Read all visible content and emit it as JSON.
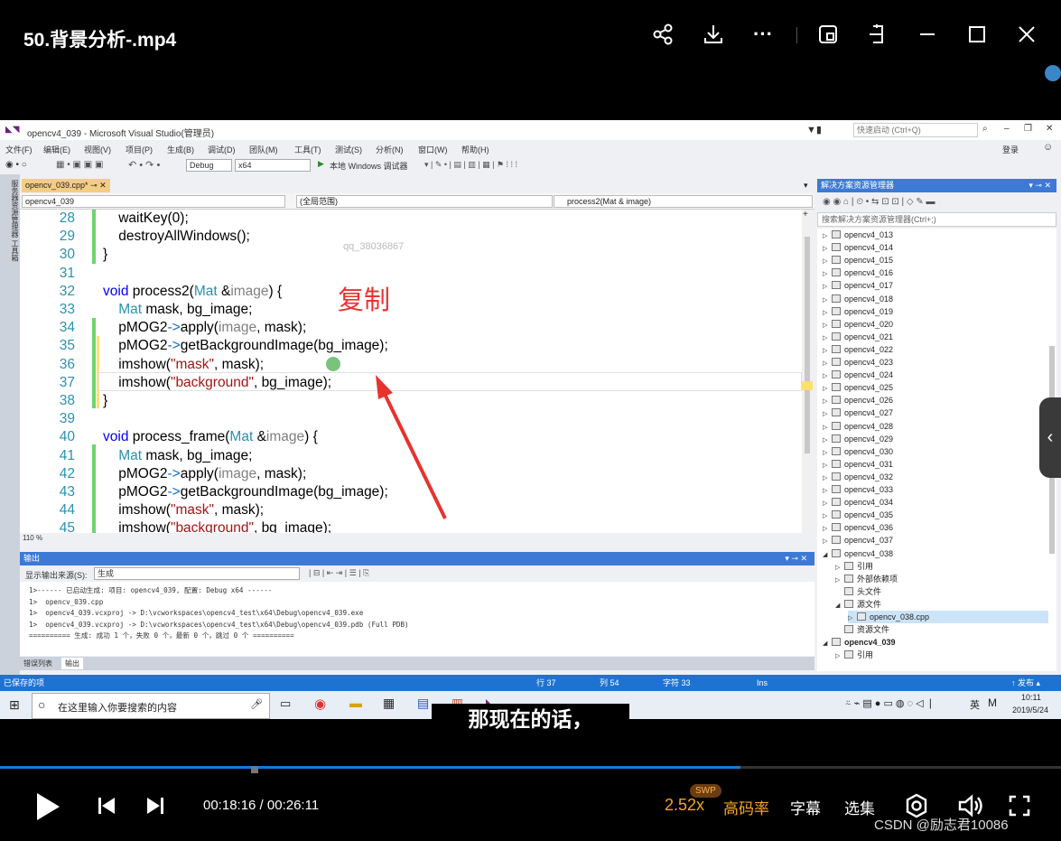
{
  "player": {
    "title": "50.背景分析-.mp4",
    "current_time": "00:18:16",
    "total_time": "00:26:11",
    "time_display": "00:18:16 / 00:26:11",
    "progress": 0.6977,
    "speed": "2.52x",
    "swp_badge": "SWP",
    "quality": "高码率",
    "subtitle_btn": "字幕",
    "episodes_btn": "选集",
    "subtitle_text": "那现在的话，",
    "watermark": "CSDN @励志君10086",
    "accent": "#0f7ae5"
  },
  "vs": {
    "window_title": "opencv4_039 - Microsoft Visual Studio(管理员)",
    "quick_launch": "快速启动 (Ctrl+Q)",
    "login": "登录",
    "menu": [
      "文件(F)",
      "编辑(E)",
      "视图(V)",
      "项目(P)",
      "生成(B)",
      "调试(D)",
      "团队(M)",
      "工具(T)",
      "测试(S)",
      "分析(N)",
      "窗口(W)",
      "帮助(H)"
    ],
    "config": "Debug",
    "platform": "x64",
    "run_label": "本地 Windows 调试器",
    "sidebar_label": "服务器资源管理器  工具箱",
    "doc_tab": "opencv_039.cpp*",
    "nav_project": "opencv4_039",
    "nav_scope": "(全局范围)",
    "nav_func": "process2(Mat & image)",
    "zoom": "110 %",
    "editor_watermark": "qq_38036867",
    "annotation": "复制",
    "code_lines": [
      {
        "n": "28",
        "text": "    waitKey(0);"
      },
      {
        "n": "29",
        "text": "    destroyAllWindows();"
      },
      {
        "n": "30",
        "text": "}"
      },
      {
        "n": "31",
        "text": ""
      },
      {
        "n": "32",
        "text": "void process2(Mat &image) {"
      },
      {
        "n": "33",
        "text": "    Mat mask, bg_image;"
      },
      {
        "n": "34",
        "text": "    pMOG2->apply(image, mask);"
      },
      {
        "n": "35",
        "text": "    pMOG2->getBackgroundImage(bg_image);"
      },
      {
        "n": "36",
        "text": "    imshow(\"mask\", mask);"
      },
      {
        "n": "37",
        "text": "    imshow(\"background\", bg_image);"
      },
      {
        "n": "38",
        "text": "}"
      },
      {
        "n": "39",
        "text": ""
      },
      {
        "n": "40",
        "text": "void process_frame(Mat &image) {"
      },
      {
        "n": "41",
        "text": "    Mat mask, bg_image;"
      },
      {
        "n": "42",
        "text": "    pMOG2->apply(image, mask);"
      },
      {
        "n": "43",
        "text": "    pMOG2->getBackgroundImage(bg_image);"
      },
      {
        "n": "44",
        "text": "    imshow(\"mask\", mask);"
      },
      {
        "n": "45",
        "text": "    imshow(\"background\", bg_image);"
      }
    ],
    "output_title": "输出",
    "output_source_label": "显示输出来源(S):",
    "output_source": "生成",
    "output_lines": [
      "1>------ 已启动生成: 项目: opencv4_039, 配置: Debug x64 ------",
      "1>  opencv_039.cpp",
      "1>  opencv4_039.vcxproj -> D:\\vcworkspaces\\opencv4_test\\x64\\Debug\\opencv4_039.exe",
      "1>  opencv4_039.vcxproj -> D:\\vcworkspaces\\opencv4_test\\x64\\Debug\\opencv4_039.pdb (Full PDB)",
      "========== 生成: 成功 1 个，失败 0 个，最新 0 个，跳过 0 个 =========="
    ],
    "output_tabs": [
      "错误列表",
      "输出"
    ],
    "se_title": "解决方案资源管理器",
    "se_search": "搜索解决方案资源管理器(Ctrl+;)",
    "projects": [
      "opencv4_013",
      "opencv4_014",
      "opencv4_015",
      "opencv4_016",
      "opencv4_017",
      "opencv4_018",
      "opencv4_019",
      "opencv4_020",
      "opencv4_021",
      "opencv4_022",
      "opencv4_023",
      "opencv4_024",
      "opencv4_025",
      "opencv4_026",
      "opencv4_027",
      "opencv4_028",
      "opencv4_029",
      "opencv4_030",
      "opencv4_031",
      "opencv4_032",
      "opencv4_033",
      "opencv4_034",
      "opencv4_035",
      "opencv4_036",
      "opencv4_037"
    ],
    "expanded_project": "opencv4_038",
    "expanded_children": [
      "引用",
      "外部依赖项",
      "头文件",
      "源文件"
    ],
    "source_file": "opencv_038.cpp",
    "resource_folder": "资源文件",
    "bold_project": "opencv4_039",
    "last_child": "引用",
    "status_saved": "已保存的项",
    "status_line": "行 37",
    "status_col": "列 54",
    "status_char": "字符 33",
    "status_ins": "Ins",
    "status_publish": "↑ 发布 ▴"
  },
  "taskbar": {
    "search_placeholder": "在这里输入你要搜索的内容",
    "ime": "英",
    "clock_time": "10:11",
    "clock_date": "2019/5/24"
  }
}
